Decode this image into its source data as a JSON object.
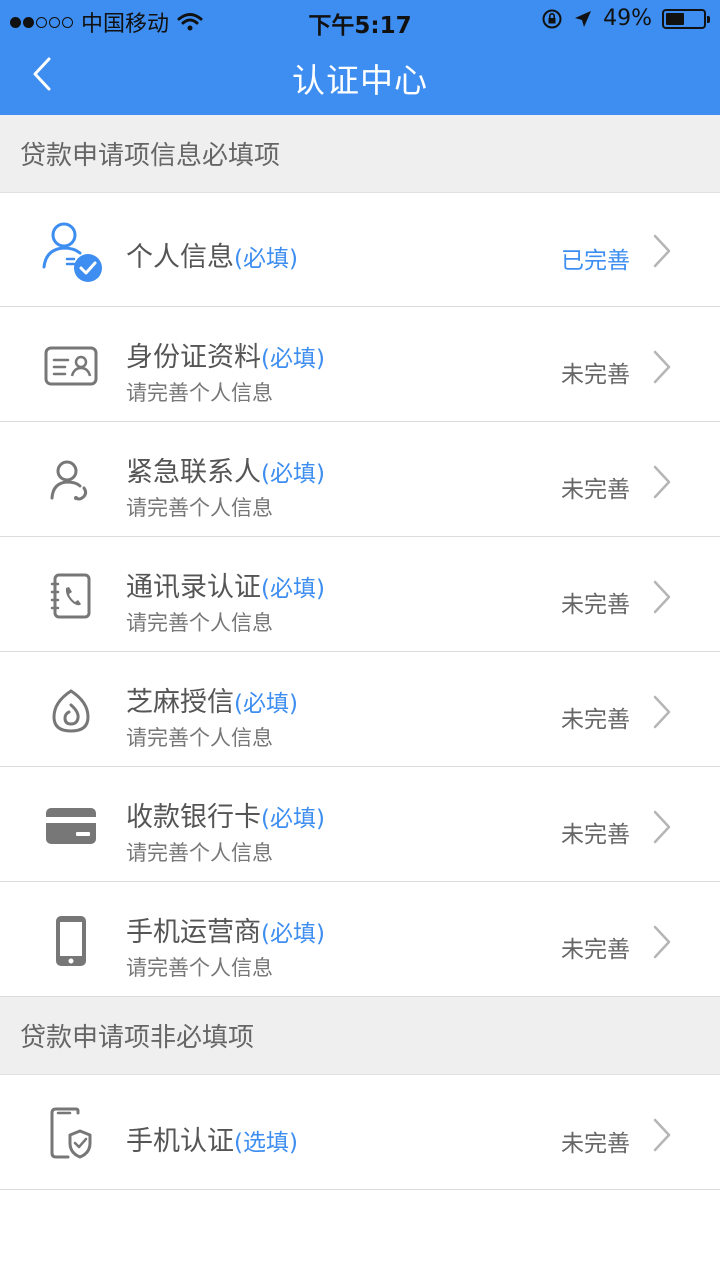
{
  "status_bar": {
    "carrier": "中国移动",
    "time": "下午5:17",
    "battery": "49%"
  },
  "navbar": {
    "title": "认证中心"
  },
  "section_required": {
    "title": "贷款申请项信息必填项"
  },
  "items": [
    {
      "name": "个人信息",
      "tag": "(必填)",
      "subtitle": "",
      "status": "已完善",
      "icon": "personal-info-verified-icon"
    },
    {
      "name": "身份证资料",
      "tag": "(必填)",
      "subtitle": "请完善个人信息",
      "status": "未完善",
      "icon": "id-card-icon"
    },
    {
      "name": "紧急联系人",
      "tag": "(必填)",
      "subtitle": "请完善个人信息",
      "status": "未完善",
      "icon": "emergency-contact-icon"
    },
    {
      "name": "通讯录认证",
      "tag": "(必填)",
      "subtitle": "请完善个人信息",
      "status": "未完善",
      "icon": "address-book-icon"
    },
    {
      "name": "芝麻授信",
      "tag": "(必填)",
      "subtitle": "请完善个人信息",
      "status": "未完善",
      "icon": "sesame-credit-icon"
    },
    {
      "name": "收款银行卡",
      "tag": "(必填)",
      "subtitle": "请完善个人信息",
      "status": "未完善",
      "icon": "bank-card-icon"
    },
    {
      "name": "手机运营商",
      "tag": "(必填)",
      "subtitle": "请完善个人信息",
      "status": "未完善",
      "icon": "mobile-phone-icon"
    }
  ],
  "section_optional": {
    "title": "贷款申请项非必填项"
  },
  "optional_items": [
    {
      "name": "手机认证",
      "tag": "(选填)",
      "status": "未完善",
      "icon": "phone-verify-shield-icon"
    }
  ],
  "colors": {
    "accent": "#3d8ef0",
    "section_bg": "#efefef",
    "text": "#555555"
  }
}
